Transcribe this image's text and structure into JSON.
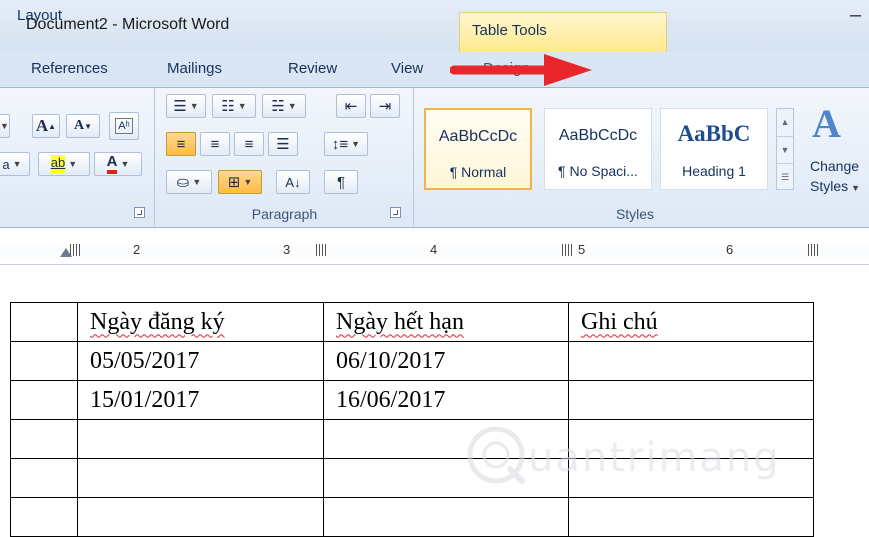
{
  "window": {
    "title": "Document2 - Microsoft Word",
    "context_tab_group": "Table Tools"
  },
  "tabs": {
    "references": "References",
    "mailings": "Mailings",
    "review": "Review",
    "view": "View",
    "design": "Design",
    "layout": "Layout"
  },
  "ribbon": {
    "font_group": {
      "grow_font": "A",
      "shrink_font": "A",
      "highlight_label": "ab",
      "font_color_label": "A"
    },
    "paragraph_group": {
      "label": "Paragraph",
      "show_marks": "¶",
      "sort": "A↓"
    },
    "styles_group": {
      "label": "Styles",
      "styles": [
        {
          "sample": "AaBbCcDc",
          "name": "¶ Normal",
          "selected": true
        },
        {
          "sample": "AaBbCcDc",
          "name": "¶ No Spaci...",
          "selected": false
        },
        {
          "sample": "AaBbC",
          "name": "Heading 1",
          "selected": false
        }
      ],
      "change_styles_line1": "Change",
      "change_styles_line2": "Styles"
    }
  },
  "ruler": {
    "numbers": [
      "2",
      "3",
      "4",
      "5",
      "6"
    ]
  },
  "document": {
    "table": {
      "headers": [
        "",
        "Ngày đăng ký",
        "Ngày hết hạn",
        "Ghi chú"
      ],
      "rows": [
        [
          "",
          "05/05/2017",
          "06/10/2017",
          ""
        ],
        [
          "",
          "15/01/2017",
          "16/06/2017",
          ""
        ],
        [
          "",
          "",
          "",
          ""
        ],
        [
          "",
          "",
          "",
          ""
        ],
        [
          "",
          "",
          "",
          ""
        ]
      ]
    }
  },
  "watermark": {
    "text": "uantrimang"
  },
  "colors": {
    "accent_arrow": "#e8262b",
    "context_tab": "#ffe98d",
    "ribbon": "#dde8f6"
  }
}
